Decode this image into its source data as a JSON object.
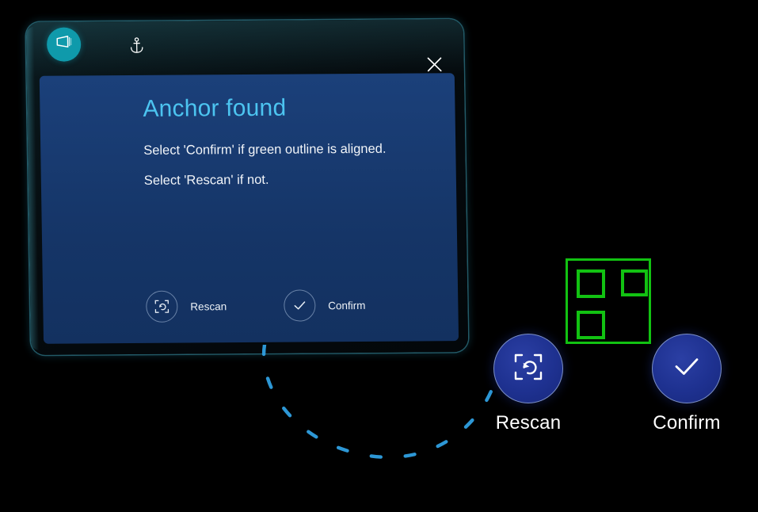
{
  "window": {
    "app_icon": "mixed-reality-app-icon",
    "anchor_icon": "anchor-icon",
    "close_icon": "close-icon"
  },
  "dialog": {
    "title": "Anchor found",
    "body_line_1": "Select 'Confirm' if green outline is aligned.",
    "body_line_2": "Select 'Rescan' if not.",
    "actions": [
      {
        "label": "Rescan",
        "icon": "rescan-icon"
      },
      {
        "label": "Confirm",
        "icon": "check-icon"
      }
    ]
  },
  "hologram_buttons": [
    {
      "label": "Rescan",
      "icon": "rescan-icon"
    },
    {
      "label": "Confirm",
      "icon": "check-icon"
    }
  ],
  "marker": {
    "name": "green-anchor-outline",
    "squares": 3
  },
  "colors": {
    "panel_blue": "#173a70",
    "title_cyan": "#4cc4f0",
    "app_badge_teal": "#0f9aab",
    "button_navy": "#1e3190",
    "marker_green": "#12c212",
    "trail_blue": "#2f9fe0",
    "background": "#000000"
  }
}
